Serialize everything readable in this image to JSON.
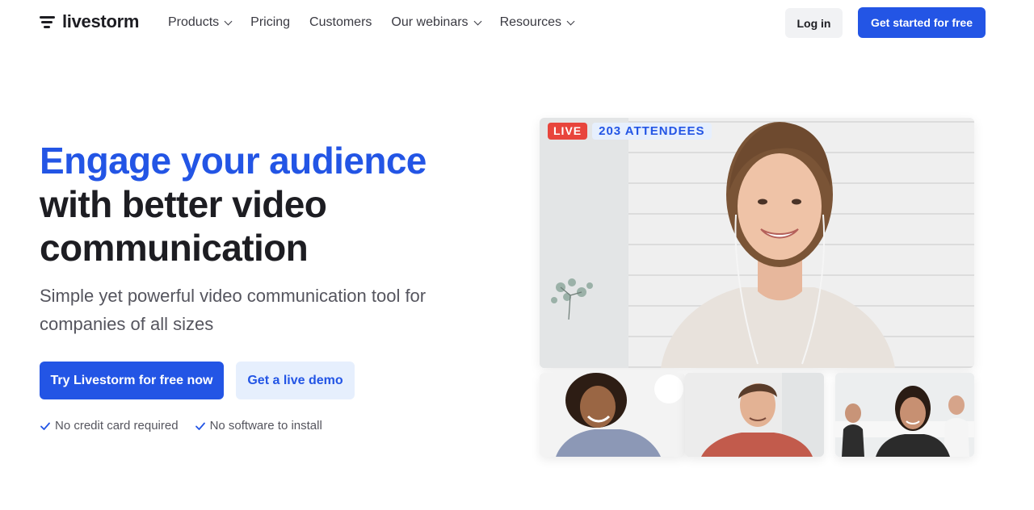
{
  "brand": {
    "name": "livestorm",
    "accent": "#2355e5",
    "dark": "#1d1d22"
  },
  "nav": {
    "links": [
      {
        "label": "Products",
        "dropdown": true
      },
      {
        "label": "Pricing",
        "dropdown": false
      },
      {
        "label": "Customers",
        "dropdown": false
      },
      {
        "label": "Our webinars",
        "dropdown": true
      },
      {
        "label": "Resources",
        "dropdown": true
      }
    ],
    "login_label": "Log in",
    "cta_label": "Get started for free"
  },
  "hero": {
    "headline_highlight": "Engage your audience",
    "headline_line2": "with better video",
    "headline_line3": "communication",
    "subtitle": "Simple yet powerful video communication tool for companies of all sizes",
    "primary_cta": "Try Livestorm for free now",
    "secondary_cta": "Get a live demo",
    "checks": [
      "No credit card required",
      "No software to install"
    ]
  },
  "video": {
    "live_badge": "LIVE",
    "attendees_badge": "203 ATTENDEES",
    "live_color": "#e8453c"
  }
}
